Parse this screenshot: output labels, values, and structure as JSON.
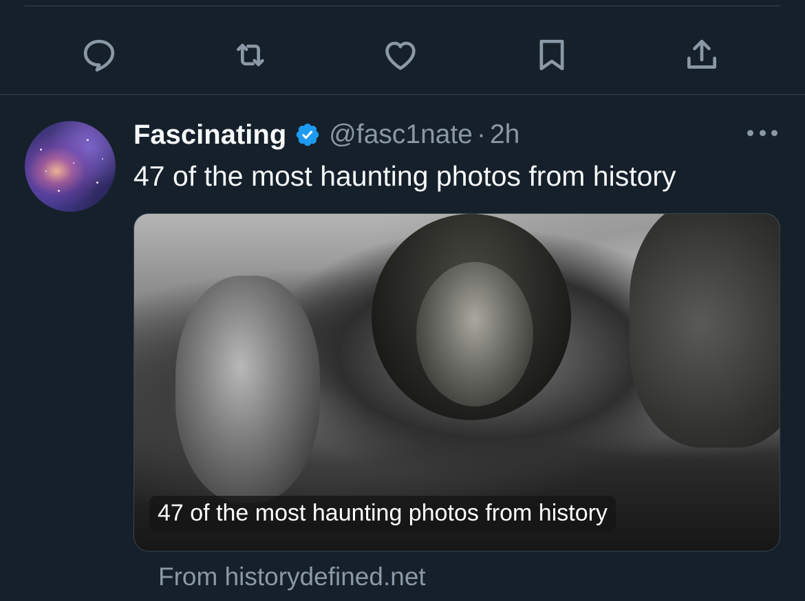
{
  "actions": {
    "reply_icon": "speech-bubble-icon",
    "retweet_icon": "retweet-arrows-icon",
    "like_icon": "heart-icon",
    "bookmark_icon": "bookmark-icon",
    "share_icon": "share-upload-icon"
  },
  "tweet": {
    "display_name": "Fascinating",
    "verified": true,
    "handle": "@fasc1nate",
    "separator": "·",
    "time": "2h",
    "text": "47 of the most haunting photos from history",
    "card": {
      "image_caption": "47 of the most haunting photos from history",
      "source": "From historydefined.net"
    }
  },
  "colors": {
    "background": "#15202b",
    "divider": "#38444d",
    "icon": "#8b98a5",
    "verified_blue": "#1d9bf0",
    "text_primary": "#f7f9f9",
    "text_secondary": "#8b98a5"
  }
}
